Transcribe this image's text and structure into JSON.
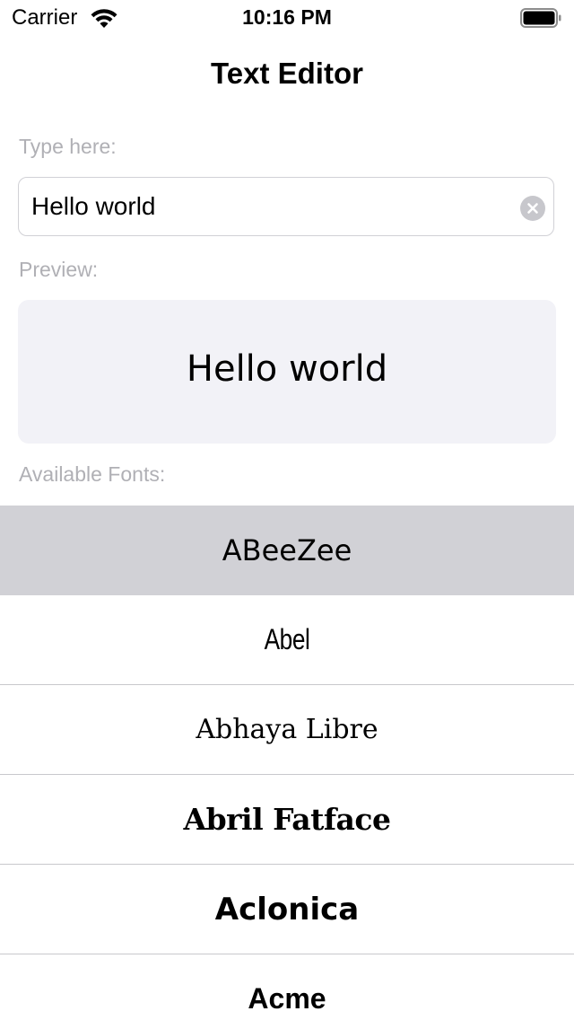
{
  "status_bar": {
    "carrier": "Carrier",
    "time": "10:16 PM",
    "wifi_icon": "wifi-icon",
    "battery_icon": "battery-icon"
  },
  "nav": {
    "title": "Text Editor"
  },
  "input": {
    "label": "Type here:",
    "value": "Hello world",
    "clear_icon": "clear-circle-icon"
  },
  "preview": {
    "label": "Preview:",
    "text": "Hello world"
  },
  "fonts": {
    "label": "Available Fonts:",
    "selected_index": 0,
    "items": [
      {
        "label": "ABeeZee"
      },
      {
        "label": "Abel"
      },
      {
        "label": "Abhaya Libre"
      },
      {
        "label": "Abril Fatface"
      },
      {
        "label": "Aclonica"
      },
      {
        "label": "Acme"
      }
    ]
  },
  "colors": {
    "secondary_label": "#b0b0b5",
    "selected_row": "#d1d1d6",
    "preview_background": "#f2f2f7",
    "separator": "#c8c8cc"
  }
}
